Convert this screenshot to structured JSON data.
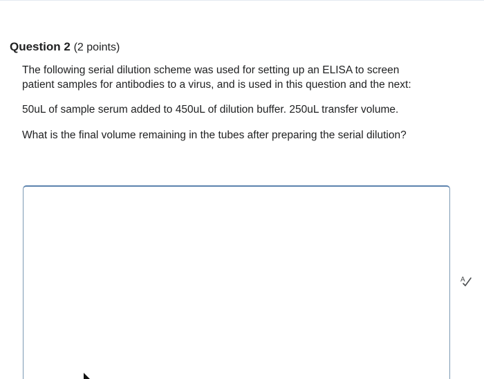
{
  "question": {
    "title": "Question 2",
    "points": "(2 points)",
    "paragraphs": [
      "The following serial dilution scheme was used for setting up an ELISA to screen",
      "patient samples for antibodies to a virus, and is used in this question and the next:",
      "50uL of sample serum added to 450uL of dilution buffer.  250uL transfer volume.",
      "What is the final volume remaining in the tubes after preparing the serial dilution?"
    ]
  },
  "answer": {
    "value": "",
    "placeholder": ""
  },
  "icons": {
    "spellcheck": "spellcheck-icon",
    "cursor": "mouse-pointer-icon"
  },
  "colors": {
    "text": "#202122",
    "border": "#7b98b3",
    "border_focus": "#5b82ad"
  }
}
